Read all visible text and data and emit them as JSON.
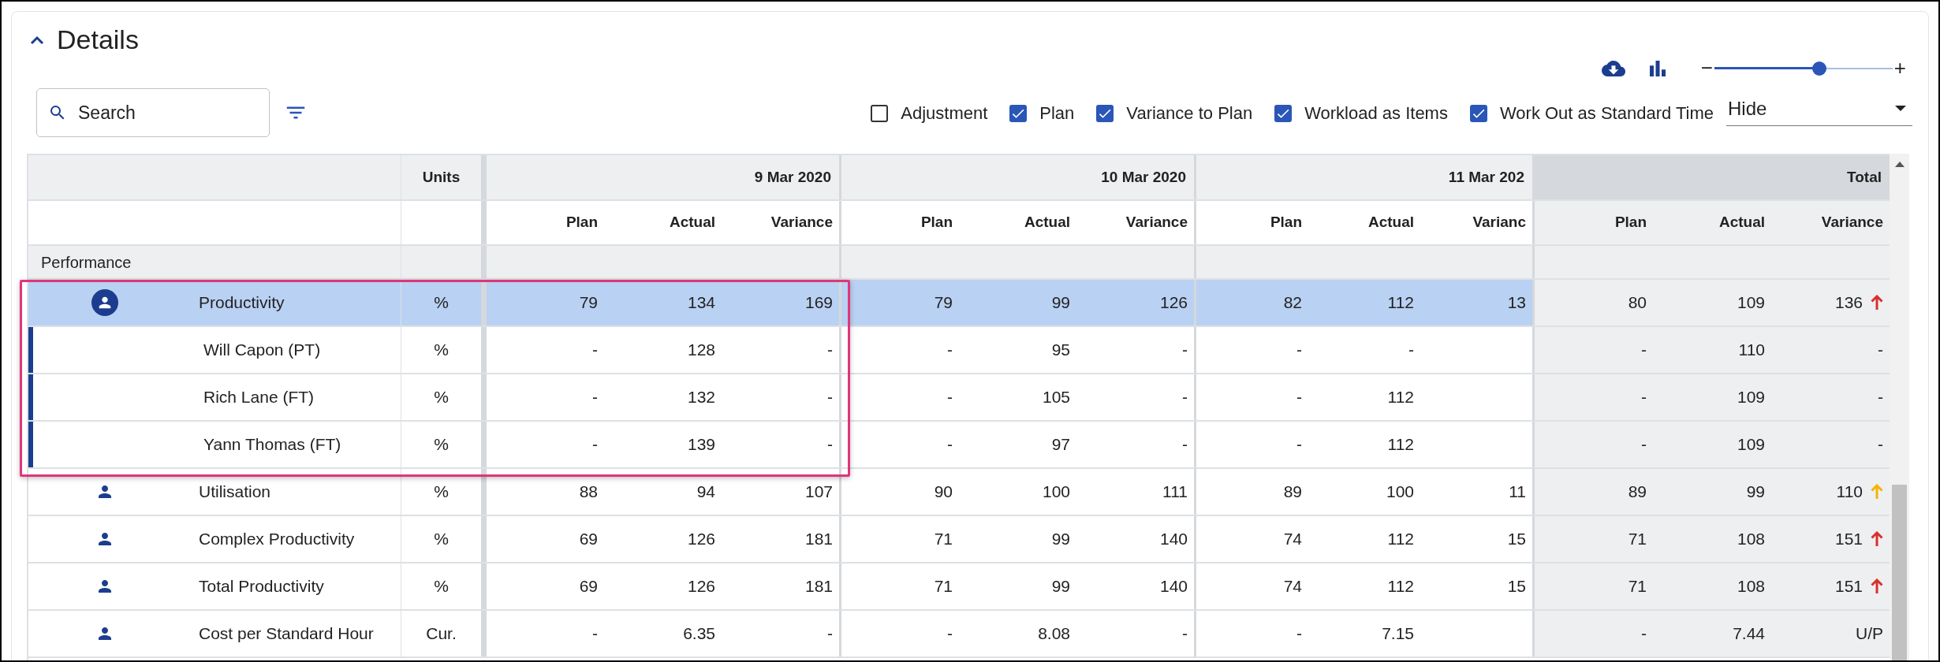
{
  "section": {
    "title": "Details",
    "expanded": true
  },
  "toolbar": {
    "search": {
      "placeholder": "Search"
    },
    "options": [
      {
        "label": "Adjustment",
        "checked": false
      },
      {
        "label": "Plan",
        "checked": true
      },
      {
        "label": "Variance to Plan",
        "checked": true
      },
      {
        "label": "Workload as Items",
        "checked": true
      },
      {
        "label": "Work Out as Standard Time",
        "checked": true
      }
    ],
    "display_select": {
      "value": "Hide"
    },
    "zoom_slider": {
      "minus": "−",
      "plus": "+",
      "level": 0.59
    }
  },
  "table": {
    "units_header": "Units",
    "groups": [
      {
        "date": "9 Mar 2020",
        "columns": [
          "Plan",
          "Actual",
          "Variance"
        ]
      },
      {
        "date": "10 Mar 2020",
        "columns": [
          "Plan",
          "Actual",
          "Variance"
        ]
      },
      {
        "date": "11 Mar 202",
        "columns": [
          "Plan",
          "Actual",
          "Varianc"
        ]
      },
      {
        "date": "Total",
        "columns": [
          "Plan",
          "Actual",
          "Variance"
        ]
      }
    ],
    "section_label": "Performance",
    "rows": [
      {
        "name": "Productivity",
        "units": "%",
        "selected": true,
        "expanded": true,
        "values": [
          [
            "79",
            "134",
            "169"
          ],
          [
            "79",
            "99",
            "126"
          ],
          [
            "82",
            "112",
            "13"
          ],
          [
            "80",
            "109",
            "136"
          ]
        ],
        "trend_arrow": {
          "color": "#d9302c"
        },
        "children": [
          {
            "name": "Will Capon (PT)",
            "units": "%",
            "selected": false,
            "values": [
              [
                "-",
                "128",
                "-"
              ],
              [
                "-",
                "95",
                "-"
              ],
              [
                "-",
                "-"
              ],
              [
                "-",
                "110",
                "-"
              ]
            ]
          },
          {
            "name": "Rich Lane (FT)",
            "units": "%",
            "selected": false,
            "values": [
              [
                "-",
                "132",
                "-"
              ],
              [
                "-",
                "105",
                "-"
              ],
              [
                "-",
                "112"
              ],
              [
                "-",
                "109",
                "-"
              ]
            ]
          },
          {
            "name": "Yann Thomas (FT)",
            "units": "%",
            "selected": false,
            "values": [
              [
                "-",
                "139",
                "-"
              ],
              [
                "-",
                "97",
                "-"
              ],
              [
                "-",
                "112"
              ],
              [
                "-",
                "109",
                "-"
              ]
            ]
          }
        ]
      },
      {
        "name": "Utilisation",
        "units": "%",
        "selected": false,
        "expanded": false,
        "values": [
          [
            "88",
            "94",
            "107"
          ],
          [
            "90",
            "100",
            "111"
          ],
          [
            "89",
            "100",
            "11"
          ],
          [
            "89",
            "99",
            "110"
          ]
        ],
        "trend_arrow": {
          "color": "#f5b400"
        }
      },
      {
        "name": "Complex Productivity",
        "units": "%",
        "selected": false,
        "expanded": false,
        "values": [
          [
            "69",
            "126",
            "181"
          ],
          [
            "71",
            "99",
            "140"
          ],
          [
            "74",
            "112",
            "15"
          ],
          [
            "71",
            "108",
            "151"
          ]
        ],
        "trend_arrow": {
          "color": "#d9302c"
        }
      },
      {
        "name": "Total Productivity",
        "units": "%",
        "selected": false,
        "expanded": false,
        "values": [
          [
            "69",
            "126",
            "181"
          ],
          [
            "71",
            "99",
            "140"
          ],
          [
            "74",
            "112",
            "15"
          ],
          [
            "71",
            "108",
            "151"
          ]
        ],
        "trend_arrow": {
          "color": "#d9302c"
        }
      },
      {
        "name": "Cost per Standard Hour",
        "units": "Cur.",
        "selected": false,
        "expanded": false,
        "values": [
          [
            "-",
            "6.35",
            "-"
          ],
          [
            "-",
            "8.08",
            "-"
          ],
          [
            "-",
            "7.15"
          ],
          [
            "-",
            "7.44",
            "U/P"
          ]
        ]
      }
    ]
  }
}
